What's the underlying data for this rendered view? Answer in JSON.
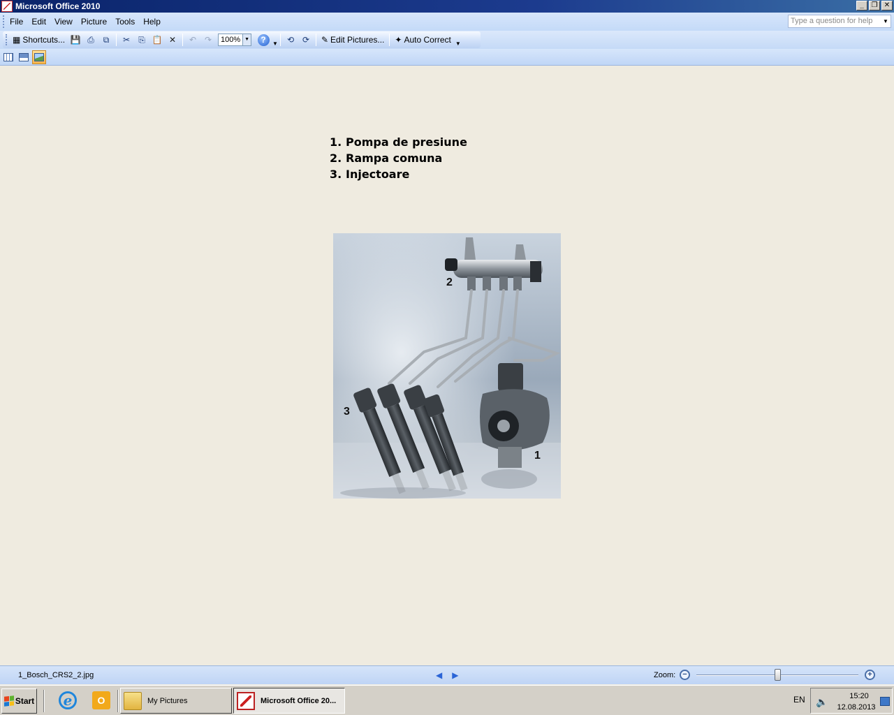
{
  "window": {
    "title": "Microsoft Office 2010",
    "controls": {
      "minimize": "_",
      "restore": "❐",
      "close": "✕"
    }
  },
  "menubar": {
    "items": [
      "File",
      "Edit",
      "View",
      "Picture",
      "Tools",
      "Help"
    ],
    "help_placeholder": "Type a question for help"
  },
  "toolbar": {
    "shortcuts_label": "Shortcuts...",
    "zoom_value": "100%",
    "edit_pictures_label": "Edit Pictures...",
    "auto_correct_label": "Auto Correct"
  },
  "document": {
    "legend": [
      {
        "num": "1.",
        "text": "Pompa de presiune"
      },
      {
        "num": "2.",
        "text": "Rampa comuna"
      },
      {
        "num": "3.",
        "text": "Injectoare"
      }
    ],
    "photo_labels": [
      "1",
      "2",
      "3"
    ]
  },
  "statusbar": {
    "filename": "1_Bosch_CRS2_2.jpg",
    "zoom_label": "Zoom:",
    "zoom_fraction": 0.5
  },
  "taskbar": {
    "start_label": "Start",
    "tasks": [
      {
        "label": "My Pictures",
        "active": false
      },
      {
        "label": "Microsoft Office 20...",
        "active": true
      }
    ],
    "language": "EN",
    "time": "15:20",
    "date": "12.08.2013"
  },
  "colors": {
    "titlebar": "#0a246a",
    "workspace": "#efebe0",
    "toolbar": "#c4daf8",
    "taskbar": "#d4d0c8"
  },
  "icons": {
    "toolbar": [
      "save-icon",
      "print-icon",
      "print-preview-icon",
      "cut-icon",
      "copy-icon",
      "paste-icon",
      "delete-icon",
      "undo-icon",
      "redo-icon",
      "help-icon",
      "rotate-left-icon",
      "rotate-right-icon"
    ],
    "view": [
      "thumbnail-view-icon",
      "filmstrip-view-icon",
      "single-picture-view-icon"
    ]
  }
}
